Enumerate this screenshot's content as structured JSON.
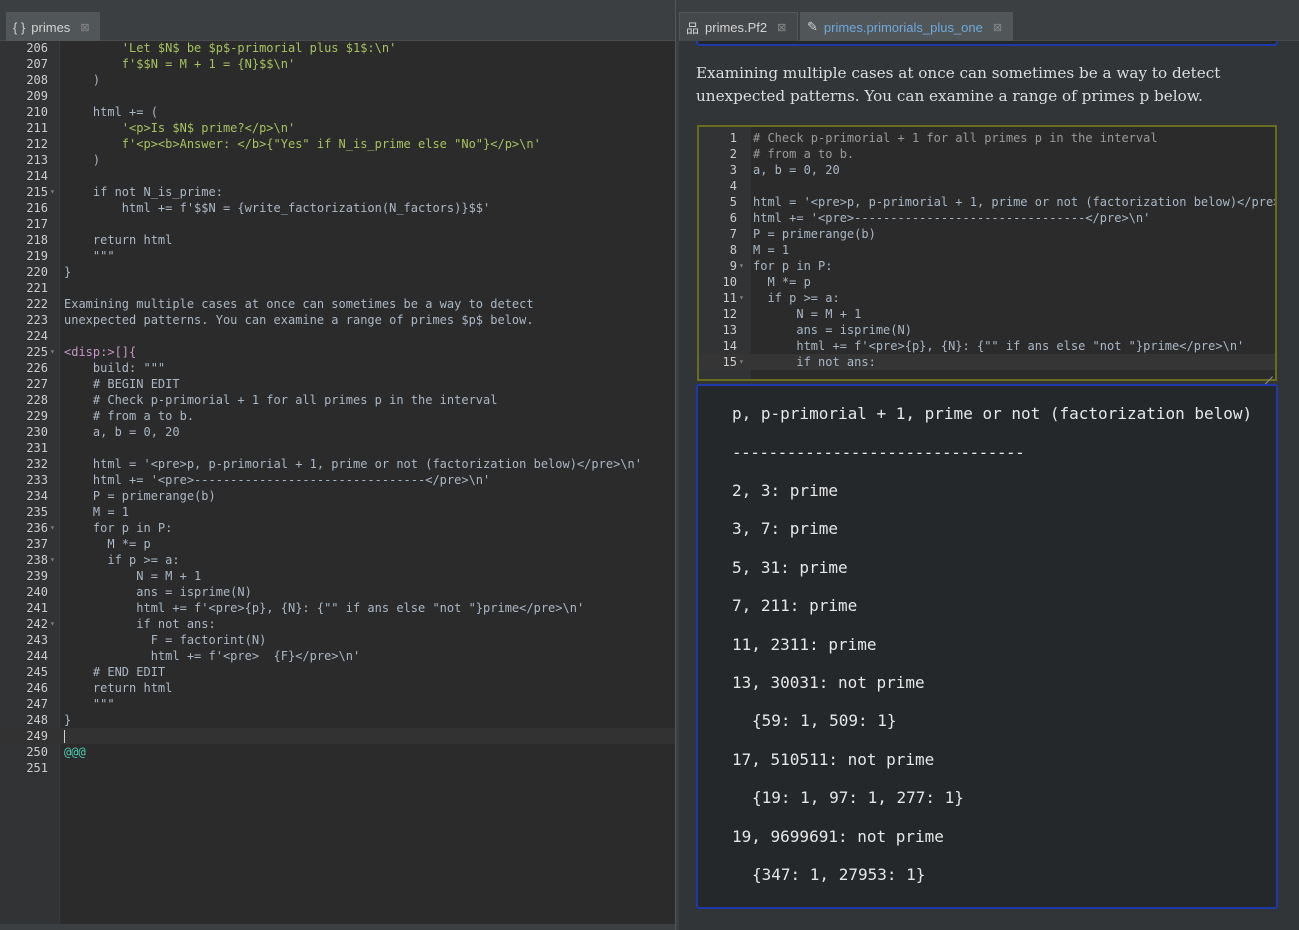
{
  "left_tab": {
    "icon": "{ }",
    "label": "primes",
    "close": "⊠"
  },
  "right_tabs": [
    {
      "icon": "品",
      "label": "primes.Pf2",
      "close": "⊠"
    },
    {
      "icon": "✎",
      "label": "primes.primorials_plus_one",
      "close": "⊠"
    }
  ],
  "editor_lines": [
    {
      "n": "206",
      "text": "        'Let $N$ be $p$-primorial plus $1$:\\n'"
    },
    {
      "n": "207",
      "text": "        f'$$N = M + 1 = {N}$$\\n'"
    },
    {
      "n": "208",
      "text": "    )"
    },
    {
      "n": "209",
      "text": ""
    },
    {
      "n": "210",
      "text": "    html += ("
    },
    {
      "n": "211",
      "text": "        '<p>Is $N$ prime?</p>\\n'"
    },
    {
      "n": "212",
      "text": "        f'<p><b>Answer: </b>{\"Yes\" if N_is_prime else \"No\"}</p>\\n'"
    },
    {
      "n": "213",
      "text": "    )"
    },
    {
      "n": "214",
      "text": ""
    },
    {
      "n": "215",
      "text": "    if not N_is_prime:",
      "fold": "▾"
    },
    {
      "n": "216",
      "text": "        html += f'$$N = {write_factorization(N_factors)}$$'"
    },
    {
      "n": "217",
      "text": ""
    },
    {
      "n": "218",
      "text": "    return html"
    },
    {
      "n": "219",
      "text": "    \"\"\""
    },
    {
      "n": "220",
      "text": "}"
    },
    {
      "n": "221",
      "text": ""
    },
    {
      "n": "222",
      "text": "Examining multiple cases at once can sometimes be a way to detect"
    },
    {
      "n": "223",
      "text": "unexpected patterns. You can examine a range of primes $p$ below."
    },
    {
      "n": "224",
      "text": ""
    },
    {
      "n": "225",
      "text": "<disp:>[]{",
      "fold": "▾"
    },
    {
      "n": "226",
      "text": "    build: \"\"\""
    },
    {
      "n": "227",
      "text": "    # BEGIN EDIT"
    },
    {
      "n": "228",
      "text": "    # Check p-primorial + 1 for all primes p in the interval"
    },
    {
      "n": "229",
      "text": "    # from a to b."
    },
    {
      "n": "230",
      "text": "    a, b = 0, 20"
    },
    {
      "n": "231",
      "text": ""
    },
    {
      "n": "232",
      "text": "    html = '<pre>p, p-primorial + 1, prime or not (factorization below)</pre>\\n'"
    },
    {
      "n": "233",
      "text": "    html += '<pre>--------------------------------</pre>\\n'"
    },
    {
      "n": "234",
      "text": "    P = primerange(b)"
    },
    {
      "n": "235",
      "text": "    M = 1"
    },
    {
      "n": "236",
      "text": "    for p in P:",
      "fold": "▾"
    },
    {
      "n": "237",
      "text": "      M *= p"
    },
    {
      "n": "238",
      "text": "      if p >= a:",
      "fold": "▾"
    },
    {
      "n": "239",
      "text": "          N = M + 1"
    },
    {
      "n": "240",
      "text": "          ans = isprime(N)"
    },
    {
      "n": "241",
      "text": "          html += f'<pre>{p}, {N}: {\"\" if ans else \"not \"}prime</pre>\\n'"
    },
    {
      "n": "242",
      "text": "          if not ans:",
      "fold": "▾"
    },
    {
      "n": "243",
      "text": "            F = factorint(N)"
    },
    {
      "n": "244",
      "text": "            html += f'<pre>  {F}</pre>\\n'"
    },
    {
      "n": "245",
      "text": "    # END EDIT"
    },
    {
      "n": "246",
      "text": "    return html"
    },
    {
      "n": "247",
      "text": "    \"\"\""
    },
    {
      "n": "248",
      "text": "}"
    },
    {
      "n": "249",
      "text": "",
      "current": true
    },
    {
      "n": "250",
      "text": "@@@"
    },
    {
      "n": "251",
      "text": ""
    }
  ],
  "prose": "Examining multiple cases at once can sometimes be a way to detect unexpected patterns. You can examine a range of primes p below.",
  "mini_lines": [
    {
      "n": "1",
      "text": "# Check p-primorial + 1 for all primes p in the interval"
    },
    {
      "n": "2",
      "text": "# from a to b."
    },
    {
      "n": "3",
      "text": "a, b = 0, 20"
    },
    {
      "n": "4",
      "text": ""
    },
    {
      "n": "5",
      "text": "html = '<pre>p, p-primorial + 1, prime or not (factorization below)</pre>\\n'"
    },
    {
      "n": "6",
      "text": "html += '<pre>--------------------------------</pre>\\n'"
    },
    {
      "n": "7",
      "text": "P = primerange(b)"
    },
    {
      "n": "8",
      "text": "M = 1"
    },
    {
      "n": "9",
      "text": "for p in P:",
      "fold": "▾"
    },
    {
      "n": "10",
      "text": "  M *= p"
    },
    {
      "n": "11",
      "text": "  if p >= a:",
      "fold": "▾"
    },
    {
      "n": "12",
      "text": "      N = M + 1"
    },
    {
      "n": "13",
      "text": "      ans = isprime(N)"
    },
    {
      "n": "14",
      "text": "      html += f'<pre>{p}, {N}: {\"\" if ans else \"not \"}prime</pre>\\n'"
    },
    {
      "n": "15",
      "text": "      if not ans:",
      "fold": "▾",
      "current": true
    }
  ],
  "output_lines": [
    {
      "text": "p, p-primorial + 1, prime or not (factorization below)"
    },
    {
      "text": "--------------------------------",
      "rule": true
    },
    {
      "text": "2, 3: prime"
    },
    {
      "text": "3, 7: prime"
    },
    {
      "text": "5, 31: prime"
    },
    {
      "text": "7, 211: prime"
    },
    {
      "text": "11, 2311: prime"
    },
    {
      "text": "13, 30031: not prime"
    },
    {
      "text": "{59: 1, 509: 1}",
      "indent": true
    },
    {
      "text": "17, 510511: not prime"
    },
    {
      "text": "{19: 1, 97: 1, 277: 1}",
      "indent": true
    },
    {
      "text": "19, 9699691: not prime"
    },
    {
      "text": "{347: 1, 27953: 1}",
      "indent": true
    }
  ],
  "colors": {
    "frame_blue": "#1f3aa8",
    "frame_olive": "#6b6b1e",
    "editor_bg": "#2b2b2b",
    "string_green": "#a5c261"
  }
}
